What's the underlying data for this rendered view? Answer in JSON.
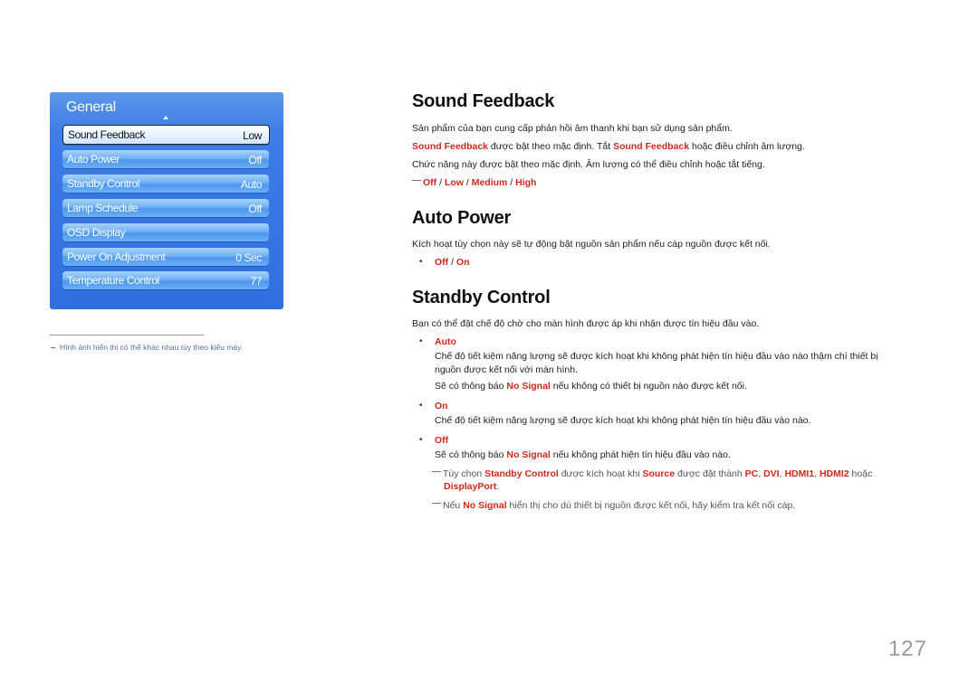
{
  "osd": {
    "title": "General",
    "items": [
      {
        "label": "Sound Feedback",
        "value": "Low",
        "selected": true
      },
      {
        "label": "Auto Power",
        "value": "Off"
      },
      {
        "label": "Standby Control",
        "value": "Auto"
      },
      {
        "label": "Lamp Schedule",
        "value": "Off"
      },
      {
        "label": "OSD Display",
        "value": ""
      },
      {
        "label": "Power On Adjustment",
        "value": "0 Sec"
      },
      {
        "label": "Temperature Control",
        "value": "77"
      }
    ]
  },
  "footnote": "Hình ảnh hiển thị có thể khác nhau tùy theo kiểu máy.",
  "sound_feedback": {
    "heading": "Sound Feedback",
    "line1": "Sản phẩm của bạn cung cấp phản hồi âm thanh khi bạn sử dụng sản phẩm.",
    "line2_a": "Sound Feedback",
    "line2_b": " được bật theo mặc định. Tắt ",
    "line2_c": "Sound Feedback",
    "line2_d": " hoặc điều chỉnh âm lượng.",
    "line3": "Chức năng này được bật theo mặc định. Âm lượng có thể điều chỉnh hoặc tắt tiếng.",
    "options": [
      "Off",
      "Low",
      "Medium",
      "High"
    ],
    "sep": " / "
  },
  "auto_power": {
    "heading": "Auto Power",
    "line1": "Kích hoạt tùy chọn này sẽ tự động bật nguồn sản phẩm nếu cáp nguồn được kết nối.",
    "options": [
      "Off",
      "On"
    ],
    "sep": " / "
  },
  "standby_control": {
    "heading": "Standby Control",
    "line1": "Bạn có thể đặt chế độ chờ cho màn hình được áp khi nhận được tín hiệu đầu vào.",
    "auto": {
      "label": "Auto",
      "desc1": "Chế độ tiết kiệm năng lượng sẽ được kích hoạt khi không phát hiện tín hiệu đầu vào nào thậm chí thiết bị",
      "desc2": "nguồn được kết nối với màn hình.",
      "desc3_a": "Sẽ có thông báo ",
      "desc3_b": "No Signal",
      "desc3_c": " nếu không có thiết bị nguồn nào được kết nối."
    },
    "on": {
      "label": "On",
      "desc1": "Chế độ tiết kiệm năng lượng sẽ được kích hoạt khi không phát hiện tín hiệu đầu vào nào."
    },
    "off": {
      "label": "Off",
      "desc1_a": "Sẽ có thông báo ",
      "desc1_b": "No Signal",
      "desc1_c": " nếu không phát hiện tín hiệu đầu vào nào."
    },
    "note1": {
      "a": "Tùy chọn ",
      "b": "Standby Control",
      "c": " được kích hoạt khi ",
      "d": "Source",
      "e": " được đặt thành ",
      "f": "PC",
      "g": ", ",
      "h": "DVI",
      "i": ", ",
      "j": "HDMI1",
      "k": ", ",
      "l": "HDMI2",
      "m": " hoặc",
      "n": "DisplayPort",
      "o": "."
    },
    "note2": {
      "a": "Nếu ",
      "b": "No Signal",
      "c": " hiển thị cho dù thiết bị nguồn được kết nối, hãy kiểm tra kết nối cáp."
    }
  },
  "page_number": "127",
  "bullet": "•"
}
